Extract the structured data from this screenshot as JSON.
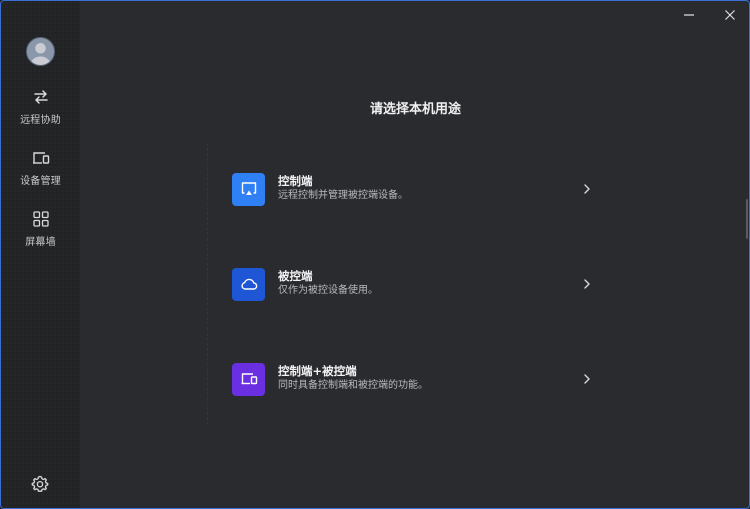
{
  "sidebar": {
    "items": [
      {
        "label": "远程协助",
        "icon": "swap-arrows-icon"
      },
      {
        "label": "设备管理",
        "icon": "devices-icon"
      },
      {
        "label": "屏幕墙",
        "icon": "grid-icon"
      }
    ],
    "settings_icon": "gear-icon",
    "avatar_icon": "user-avatar"
  },
  "window_controls": {
    "minimize_icon": "minimize-icon",
    "close_icon": "close-icon"
  },
  "main": {
    "title": "请选择本机用途",
    "options": [
      {
        "title": "控制端",
        "description": "远程控制并管理被控端设备。",
        "icon": "airplay-icon",
        "color": "#2f7ff5"
      },
      {
        "title": "被控端",
        "description": "仅作为被控设备使用。",
        "icon": "cloud-icon",
        "color": "#1f56d6"
      },
      {
        "title": "控制端+被控端",
        "description": "同时具备控制端和被控端的功能。",
        "icon": "devices-icon",
        "color": "#6a2fe0"
      }
    ]
  },
  "colors": {
    "background": "#2a2b2e",
    "sidebar": "#222325",
    "accent_border": "#3b6fd6"
  }
}
